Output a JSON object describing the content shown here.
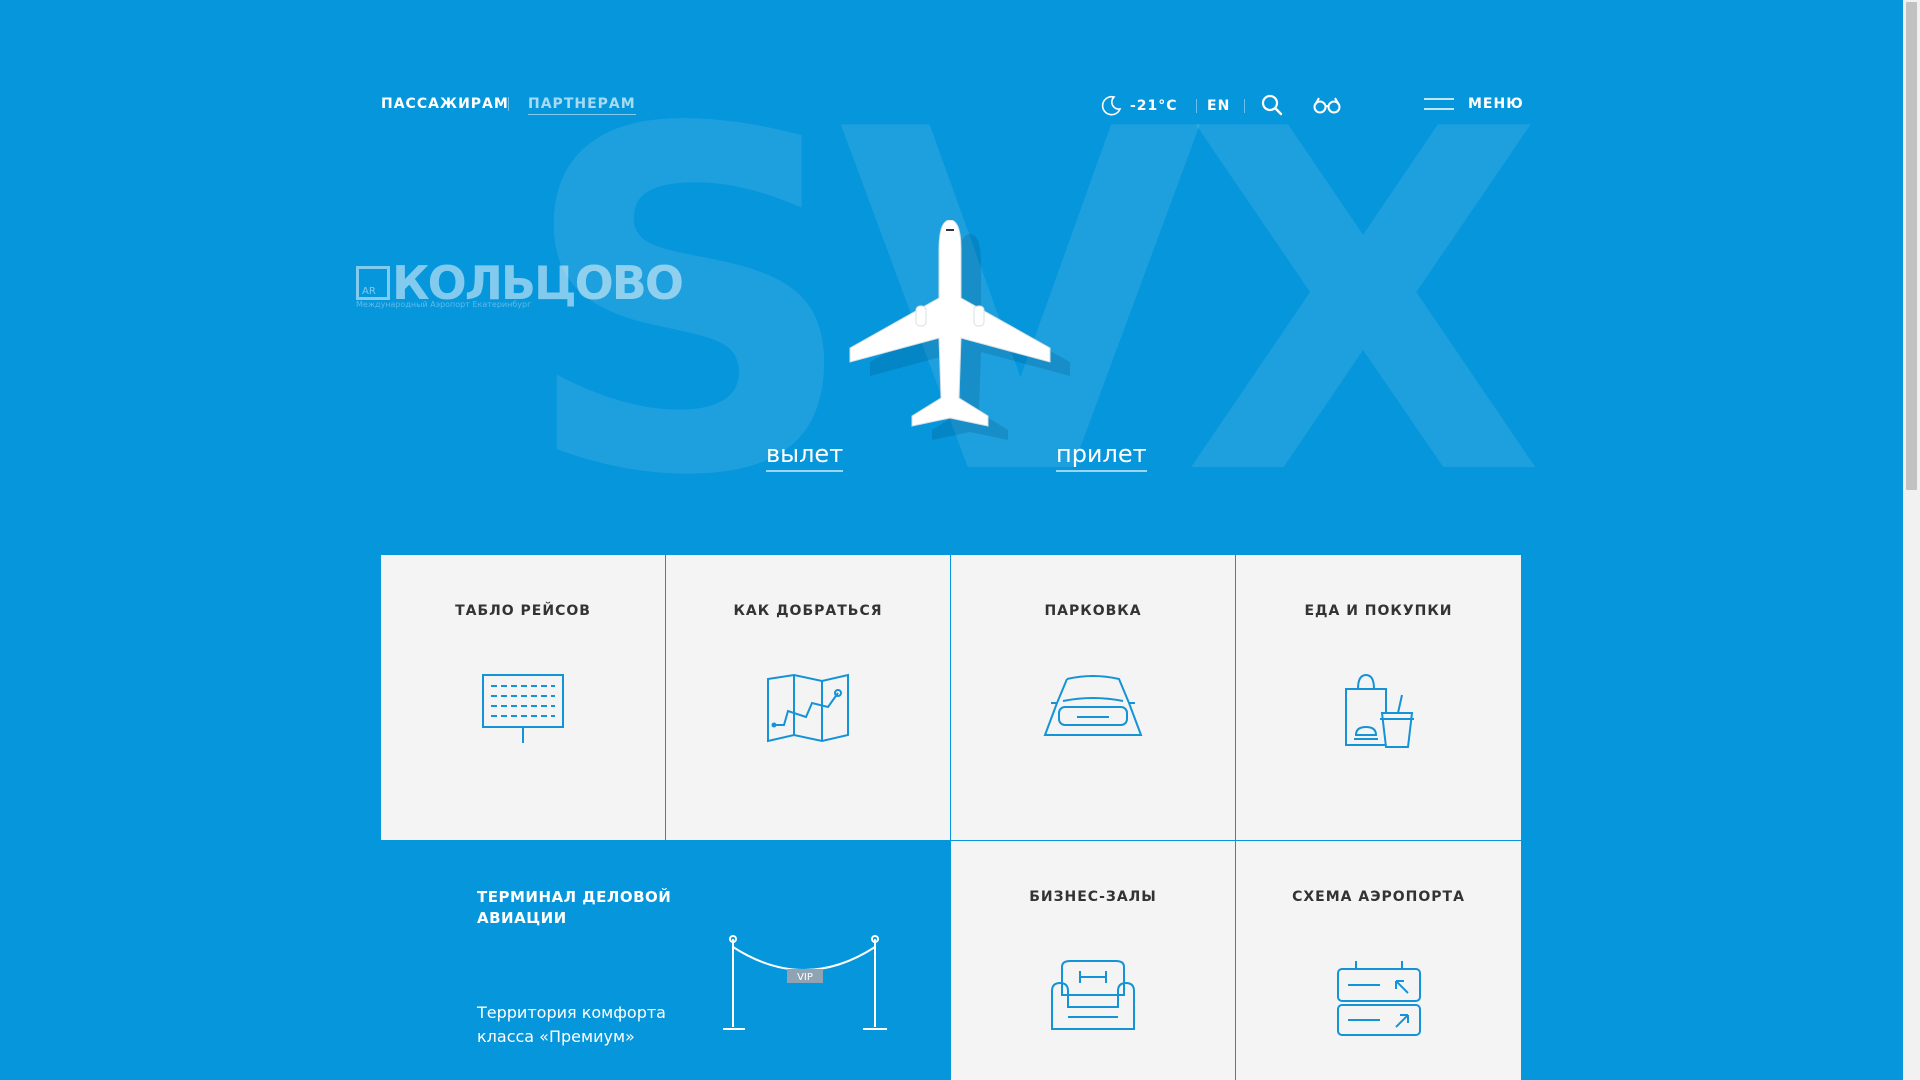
{
  "header": {
    "passengers": "ПАССАЖИРАМ",
    "partners": "ПАРТНЕРАМ",
    "weather": "-21°С",
    "lang": "EN",
    "menu": "МЕНЮ"
  },
  "hero": {
    "airport_code": "SVX",
    "logo_name": "КОЛЬЦОВО",
    "logo_tagline": "Международный Аэропорт Екатеринбург",
    "logo_mark": "AR",
    "departure": "вылет",
    "arrival": "прилет"
  },
  "tiles": [
    {
      "label": "ТАБЛО РЕЙСОВ",
      "icon": "board-icon"
    },
    {
      "label": "КАК ДОБРАТЬСЯ",
      "icon": "map-icon"
    },
    {
      "label": "ПАРКОВКА",
      "icon": "car-icon"
    },
    {
      "label": "ЕДА И ПОКУПКИ",
      "icon": "shopping-icon"
    },
    {
      "label": "БИЗНЕС-ЗАЛЫ",
      "icon": "armchair-icon"
    },
    {
      "label": "СХЕМА АЭРОПОРТА",
      "icon": "airport-scheme-icon"
    }
  ],
  "business_terminal": {
    "title": "ТЕРМИНАЛ ДЕЛОВОЙ АВИАЦИИ",
    "text": "Территория комфорта класса «Премиум»",
    "vip": "VIP"
  },
  "colors": {
    "background": "#0596dc",
    "tile": "#f4f4f4",
    "icon": "#1493d6"
  }
}
